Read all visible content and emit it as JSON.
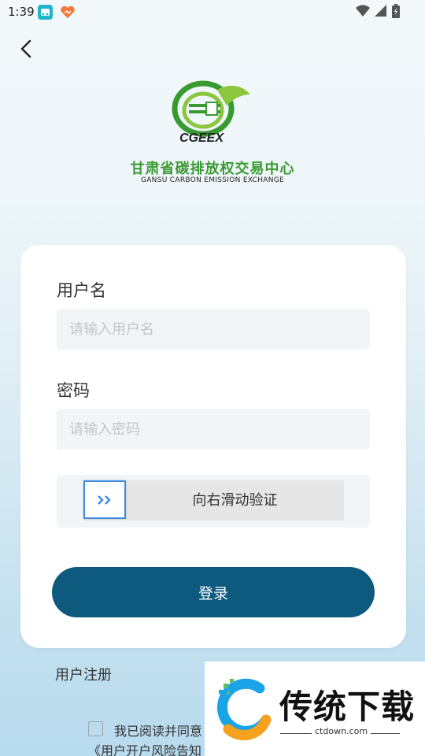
{
  "status_bar": {
    "time": "1:39"
  },
  "brand": {
    "logo_text": "CGEEX",
    "name_cn": "甘肃省碳排放权交易中心",
    "name_en": "GANSU CARBON EMISSION EXCHANGE"
  },
  "form": {
    "username_label": "用户名",
    "username_placeholder": "请输入用户名",
    "password_label": "密码",
    "password_placeholder": "请输入密码",
    "slider_text": "向右滑动验证",
    "login_label": "登录"
  },
  "register_label": "用户注册",
  "agreement": {
    "text": "我已阅读并同意",
    "doc": "《用户开户风险告知"
  },
  "watermark": {
    "title": "传统下载",
    "url": "ctdown.com"
  },
  "colors": {
    "primary": "#0d5a7e",
    "brand_green": "#3a9a32",
    "slider_border": "#3d8bde"
  }
}
